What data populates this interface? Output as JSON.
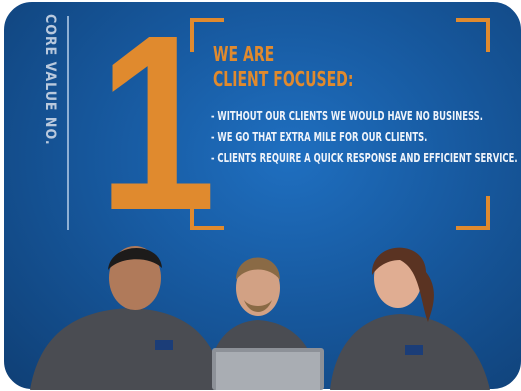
{
  "poster": {
    "side_label": "CORE VALUE NO.",
    "number": "1",
    "title_line1": "WE ARE",
    "title_line2": "CLIENT FOCUSED:",
    "bullets": [
      "-  WITHOUT OUR CLIENTS WE WOULD HAVE NO BUSINESS.",
      "-  WE GO THAT EXTRA MILE FOR OUR CLIENTS.",
      "-  CLIENTS REQUIRE A QUICK RESPONSE AND EFFICIENT SERVICE."
    ]
  },
  "colors": {
    "accent": "#e08a2e",
    "background": "#17599f",
    "shirt": "#4a4c52"
  }
}
